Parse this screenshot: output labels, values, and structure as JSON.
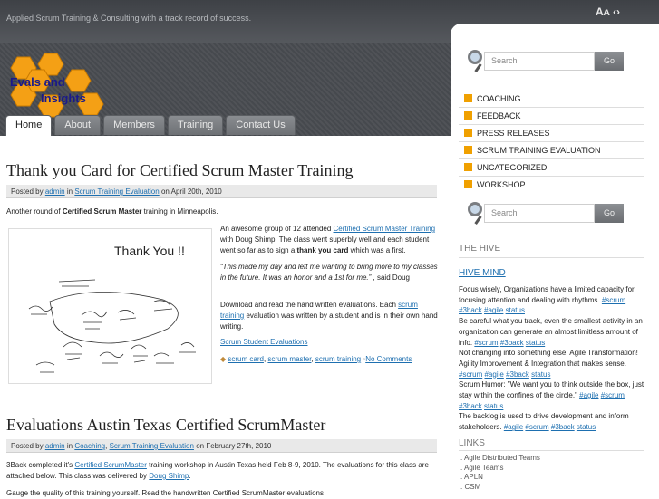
{
  "site": {
    "tagline": "Applied Scrum Training & Consulting with a track record of success.",
    "font_tools": "Aᴀ ‹›",
    "logo_line1": "Evals and",
    "logo_line2": "Insights"
  },
  "nav": [
    "Home",
    "About",
    "Members",
    "Training",
    "Contact Us"
  ],
  "post1": {
    "title": "Thank you Card for Certified Scrum Master Training",
    "meta_prefix": "Posted by",
    "meta_author": "admin",
    "meta_in": "in",
    "meta_cat": "Scrum Training Evaluation",
    "meta_date": "on April 20th, 2010",
    "intro_a": "Another round of ",
    "intro_b": "Certified Scrum Master",
    "intro_c": " training in Minneapolis.",
    "card_text": "Thank You !!",
    "p1_a": "An awesome group of 12 attended ",
    "p1_link": "Certified Scrum Master Training",
    "p1_b": " with Doug Shimp. The class went superbly well and each student went so far as to sign a ",
    "p1_bold": "thank you card",
    "p1_c": " which was a first.",
    "quote": "“This made my day and left me wanting to bring more to my classes in the future. It was an honor and a 1st for me.”",
    "quote_by": " , said Doug",
    "p3_a": "Download and read the hand written evaluations. Each ",
    "p3_link": "scrum training",
    "p3_b": " evaluation was written by a student and is in their own hand writing.",
    "eval_link": "Scrum Student Evaluations",
    "tags": [
      "scrum card",
      "scrum master",
      "scrum training"
    ],
    "comments": "No Comments"
  },
  "post2": {
    "title": "Evaluations Austin Texas Certified ScrumMaster",
    "meta_prefix": "Posted by",
    "meta_author": "admin",
    "meta_in": "in",
    "meta_cat1": "Coaching",
    "meta_cat2": "Scrum Training Evaluation",
    "meta_date": "on February 27th, 2010",
    "p1_a": "3Back completed it's ",
    "p1_link": "Certified ScrumMaster",
    "p1_b": " training workshop  in Austin Texas held Feb 8-9, 2010. The evaluations for this class are attached below. This class was delivered by ",
    "p1_link2": "Doug Shimp",
    "p2": "Gauge the quality of this training yourself. Read the handwritten Certified ScrumMaster evaluations"
  },
  "sidebar": {
    "search_placeholder": "Search",
    "search_button": "Go",
    "categories": [
      "COACHING",
      "FEEDBACK",
      "PRESS RELEASES",
      "SCRUM TRAINING EVALUATION",
      "UNCATEGORIZED",
      "WORKSHOP"
    ],
    "hive_heading": "THE HIVE",
    "hive_title": "HIVE MIND",
    "hive_items": [
      {
        "text": "Focus wisely, Organizations have a limited capacity for focusing attention and dealing with rhythms. ",
        "tags": [
          "#scrum",
          "#3back",
          "#agile",
          "status"
        ]
      },
      {
        "text": "Be careful what you track, even the smallest activity in an organization can generate an almost limitless amount of info. ",
        "tags": [
          "#scrum",
          "#3back",
          "status"
        ]
      },
      {
        "text": "Not changing into something else, Agile Transformation! Agility Improvement & Integration that makes sense. ",
        "tags": [
          "#scrum",
          "#agile",
          "#3back",
          "status"
        ]
      },
      {
        "text": "Scrum Humor: \"We want you to think outside the box, just stay within the confines of the circle.\" ",
        "tags": [
          "#agile",
          "#scrum",
          "#3back",
          "status"
        ]
      },
      {
        "text": "The backlog is used to drive development and inform stakeholders. ",
        "tags": [
          "#agile",
          "#scrum",
          "#3back",
          "status"
        ]
      }
    ],
    "links_heading": "LINKS",
    "links": [
      "Agile Distributed Teams",
      "Agile Teams",
      "APLN",
      "CSM"
    ]
  },
  "colors": {
    "accent_orange": "#f0a000",
    "link": "#1d6fb0",
    "header": "#4a4d52"
  }
}
